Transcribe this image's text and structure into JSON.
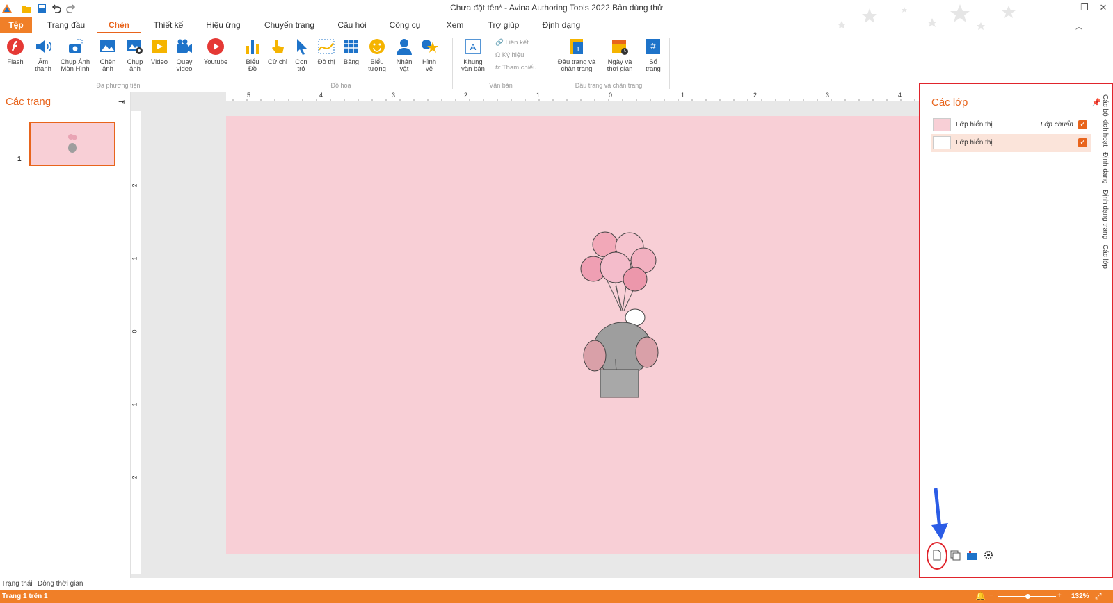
{
  "window": {
    "title": "Chưa đặt tên* - Avina Authoring Tools 2022 Bản dùng thử"
  },
  "tabs": [
    "Tệp",
    "Trang đầu",
    "Chèn",
    "Thiết kế",
    "Hiệu ứng",
    "Chuyển trang",
    "Câu hỏi",
    "Công cụ",
    "Xem",
    "Trợ giúp",
    "Định dạng"
  ],
  "ribbon": {
    "media": {
      "label": "Đa phương tiện",
      "buttons": [
        "Flash",
        "Âm thanh",
        "Chụp Ảnh Màn Hình",
        "Chèn ảnh",
        "Chụp ảnh",
        "Video",
        "Quay video",
        "Youtube"
      ]
    },
    "graphics": {
      "label": "Đồ hoạ",
      "buttons": [
        "Biểu Đồ",
        "Cử chỉ",
        "Con trỏ",
        "Đồ thị",
        "Bảng",
        "Biểu tượng",
        "Nhân vật",
        "Hình vẽ"
      ]
    },
    "text": {
      "label": "Văn bản",
      "buttons": [
        "Khung văn bản"
      ],
      "small": [
        "Liên kết",
        "Ký hiệu",
        "Tham chiếu"
      ]
    },
    "header_footer": {
      "label": "Đầu trang và chân trang",
      "buttons": [
        "Đầu trang và chân trang",
        "Ngày và thời gian",
        "Số trang"
      ]
    }
  },
  "left_panel": {
    "title": "Các trang",
    "slide_number": "1"
  },
  "rulers": {
    "horizontal": [
      "5",
      "4",
      "3",
      "2",
      "1",
      "0",
      "1",
      "2",
      "3",
      "4"
    ],
    "vertical": [
      "2",
      "1",
      "0",
      "1",
      "2"
    ]
  },
  "right_panel": {
    "title": "Các lớp",
    "layers": [
      {
        "name": "Lớp hiển thị",
        "tag": "Lớp chuẩn",
        "checked": true
      },
      {
        "name": "Lớp hiển thị",
        "tag": "",
        "checked": true
      }
    ],
    "side_tabs": [
      "Các bộ kích hoạt",
      "Định dạng",
      "Định dạng trang",
      "Các lớp"
    ]
  },
  "status": {
    "tabs": [
      "Trạng thái",
      "Dòng thời gian"
    ],
    "page_info": "Trang 1 trên 1",
    "zoom": "132%"
  },
  "colors": {
    "accent": "#e8641c",
    "slide_bg": "#f8cfd6",
    "highlight": "#e0242c"
  }
}
